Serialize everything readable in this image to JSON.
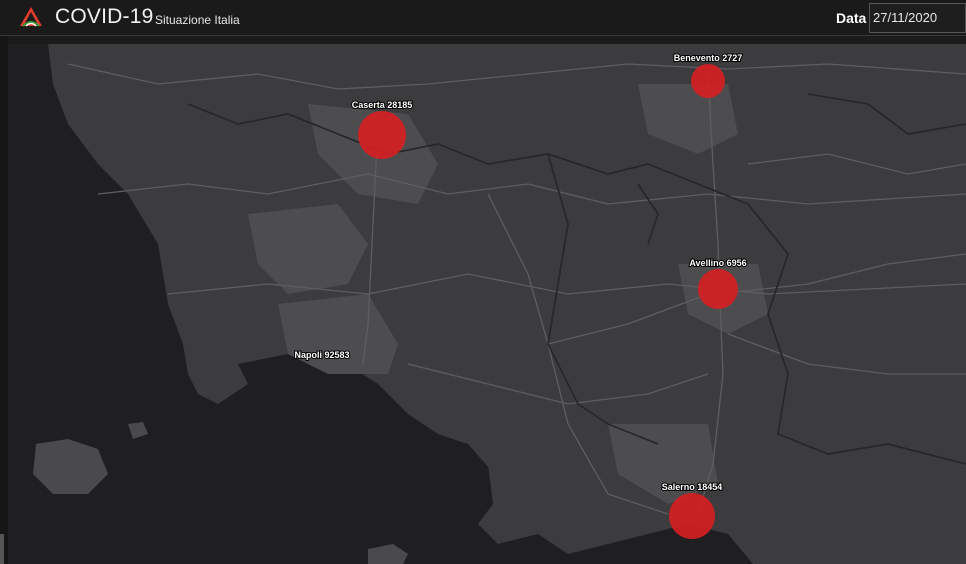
{
  "header": {
    "title": "COVID-19",
    "subtitle": "Situazione Italia",
    "date_label": "Data",
    "date_value": "27/11/2020"
  },
  "map": {
    "marker_color": "#d51f22",
    "cities": [
      {
        "name": "Caserta",
        "cases": 28185,
        "label": "Caserta 28185"
      },
      {
        "name": "Benevento",
        "cases": 2727,
        "label": "Benevento 2727"
      },
      {
        "name": "Avellino",
        "cases": 6956,
        "label": "Avellino 6956"
      },
      {
        "name": "Napoli",
        "cases": 92583,
        "label": "Napoli 92583"
      },
      {
        "name": "Salerno",
        "cases": 18454,
        "label": "Salerno 18454"
      }
    ]
  }
}
